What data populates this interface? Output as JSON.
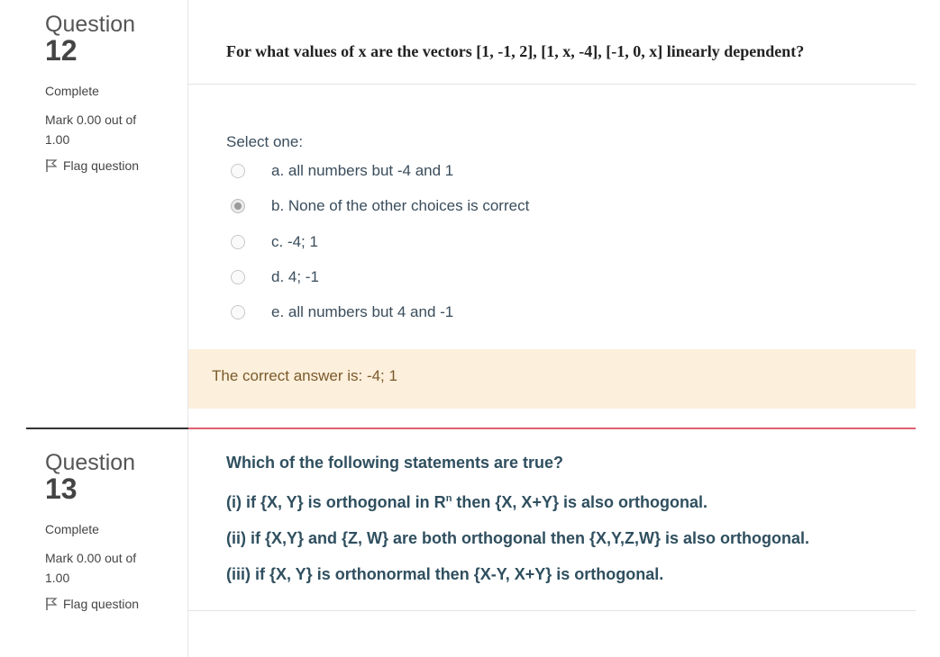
{
  "q12": {
    "word": "Question",
    "number": "12",
    "state": "Complete",
    "mark_line1": "Mark 0.00 out of",
    "mark_line2": "1.00",
    "flag_label": "Flag question",
    "text": "For what values of x are the vectors [1, -1, 2], [1, x, -4], [-1, 0, x] linearly dependent?",
    "prompt": "Select one:",
    "options": [
      {
        "label": "a. all numbers but -4 and 1",
        "checked": false
      },
      {
        "label": "b. None of the other choices is correct",
        "checked": true
      },
      {
        "label": "c. -4; 1",
        "checked": false
      },
      {
        "label": "d. 4; -1",
        "checked": false
      },
      {
        "label": "e. all numbers but 4 and -1",
        "checked": false
      }
    ],
    "feedback": "The correct answer is: -4; 1"
  },
  "q13": {
    "word": "Question",
    "number": "13",
    "state": "Complete",
    "mark_line1": "Mark 0.00 out of",
    "mark_line2": "1.00",
    "flag_label": "Flag question",
    "lines": [
      "Which of the following statements are true?",
      "(i) if {X, Y} is orthogonal in R",
      "(ii) if {X,Y} and {Z, W} are both orthogonal then {X,Y,Z,W} is also orthogonal.",
      "(iii) if {X, Y} is orthonormal then {X-Y, X+Y} is orthogonal."
    ],
    "line2_sup": "n",
    "line2_rest": " then {X, X+Y} is also orthogonal."
  },
  "colors": {
    "divider_dark": "#333333",
    "divider_red": "#e06070",
    "feedback_bg": "#fcefdc"
  }
}
